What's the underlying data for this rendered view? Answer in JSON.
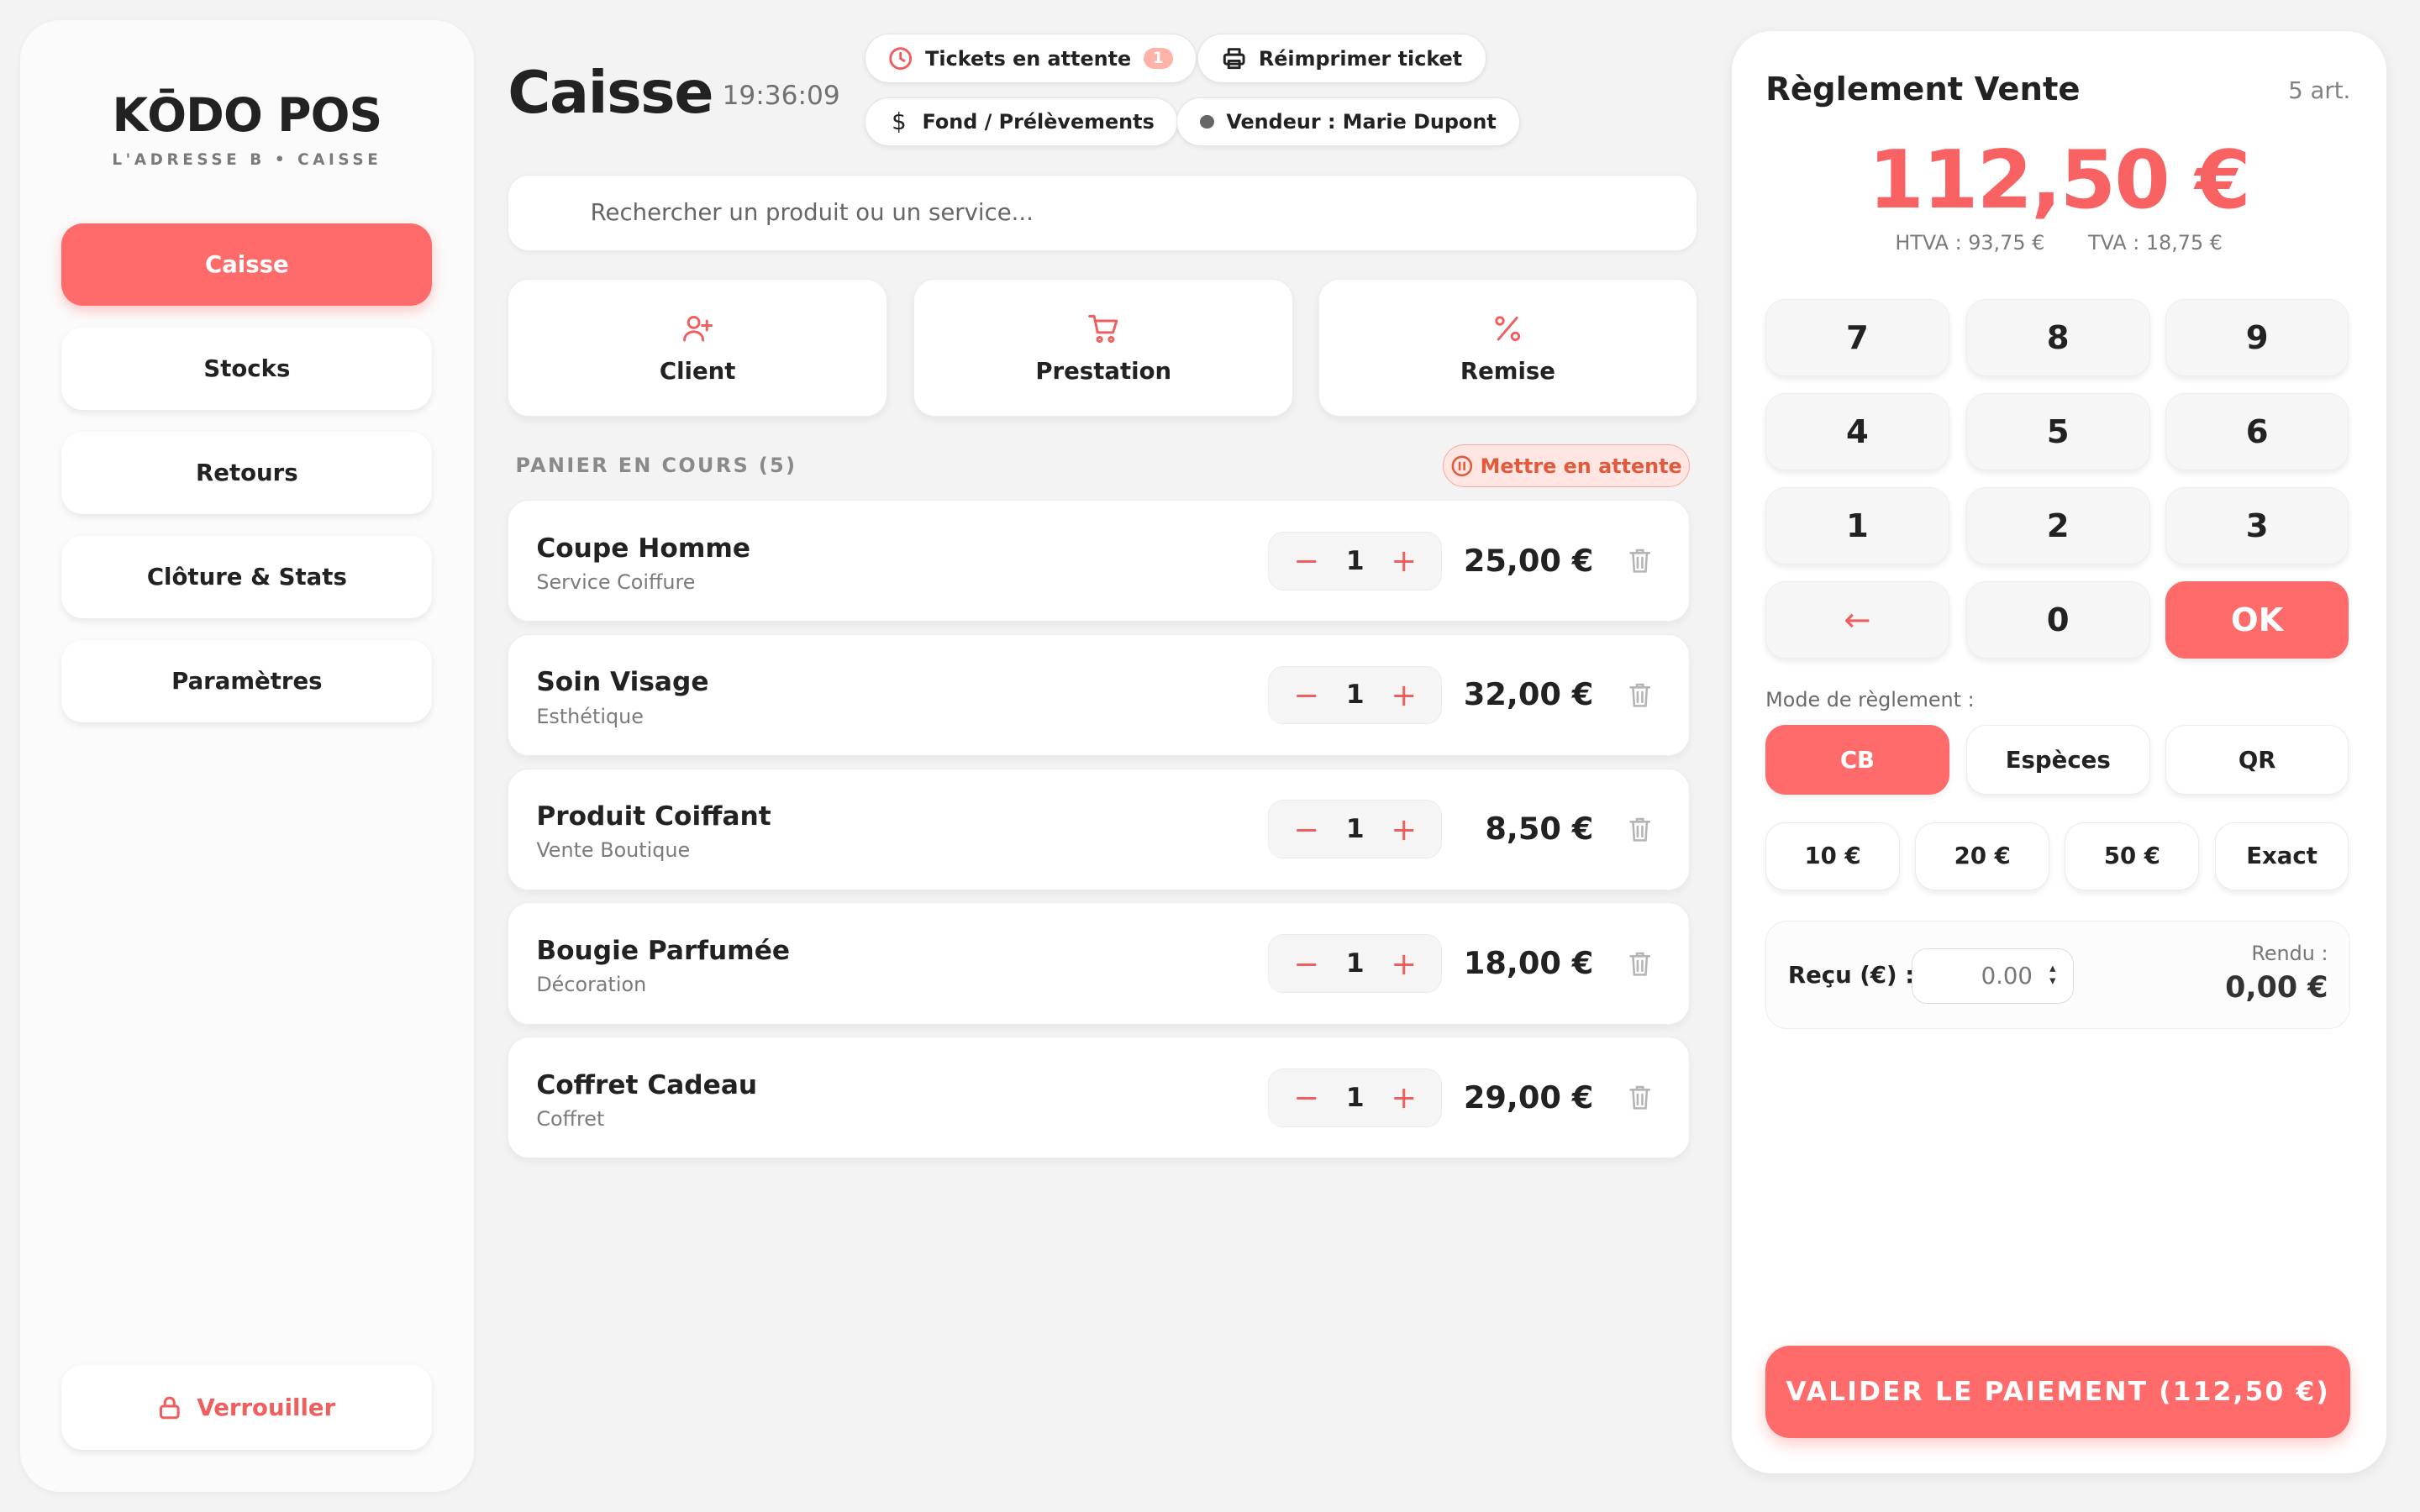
{
  "colors": {
    "accent": "#ff6b6b",
    "background": "#f3f3f4",
    "panel": "#ffffff"
  },
  "brand": {
    "name": "KŌDO POS",
    "subtitle": "L'ADRESSE B • CAISSE"
  },
  "sidebar": {
    "items": [
      {
        "label": "Caisse",
        "active": true
      },
      {
        "label": "Stocks",
        "active": false
      },
      {
        "label": "Retours",
        "active": false
      },
      {
        "label": "Clôture & Stats",
        "active": false
      },
      {
        "label": "Paramètres",
        "active": false
      }
    ],
    "lock_label": "Verrouiller",
    "lock_icon": "lock-icon"
  },
  "header": {
    "title": "Caisse",
    "time": "19:36:09",
    "pending_tickets_label": "Tickets en attente",
    "pending_tickets_count": "1",
    "reprint_label": "Réimprimer ticket",
    "float_label": "Fond / Prélèvements",
    "seller_label": "Vendeur : Marie Dupont"
  },
  "search": {
    "placeholder": "Rechercher un produit ou un service..."
  },
  "actions": [
    {
      "label": "Client",
      "icon": "add-user-icon"
    },
    {
      "label": "Prestation",
      "icon": "cart-icon"
    },
    {
      "label": "Remise",
      "icon": "percent-icon"
    }
  ],
  "cart": {
    "heading": "PANIER EN COURS (5)",
    "hold_label": "Mettre en attente",
    "items": [
      {
        "name": "Coupe Homme",
        "category": "Service Coiffure",
        "qty": "1",
        "price": "25,00 €"
      },
      {
        "name": "Soin Visage",
        "category": "Esthétique",
        "qty": "1",
        "price": "32,00 €"
      },
      {
        "name": "Produit Coiffant",
        "category": "Vente Boutique",
        "qty": "1",
        "price": "8,50 €"
      },
      {
        "name": "Bougie Parfumée",
        "category": "Décoration",
        "qty": "1",
        "price": "18,00 €"
      },
      {
        "name": "Coffret Cadeau",
        "category": "Coffret",
        "qty": "1",
        "price": "29,00 €"
      }
    ],
    "minus": "−",
    "plus": "+"
  },
  "payment": {
    "title": "Règlement Vente",
    "count": "5 art.",
    "total": "112,50 €",
    "htva": "HTVA : 93,75 €",
    "tva": "TVA : 18,75 €",
    "keypad": [
      "7",
      "8",
      "9",
      "4",
      "5",
      "6",
      "1",
      "2",
      "3",
      "←",
      "0",
      "OK"
    ],
    "mode_label": "Mode de règlement :",
    "modes": [
      {
        "label": "CB",
        "active": true
      },
      {
        "label": "Espèces",
        "active": false
      },
      {
        "label": "QR",
        "active": false
      }
    ],
    "quick_amounts": [
      "10 €",
      "20 €",
      "50 €",
      "Exact"
    ],
    "received_label": "Reçu (€) :",
    "received_value": "0.00",
    "change_label": "Rendu :",
    "change_value": "0,00 €",
    "validate_label": "VALIDER LE PAIEMENT (112,50 €)"
  }
}
